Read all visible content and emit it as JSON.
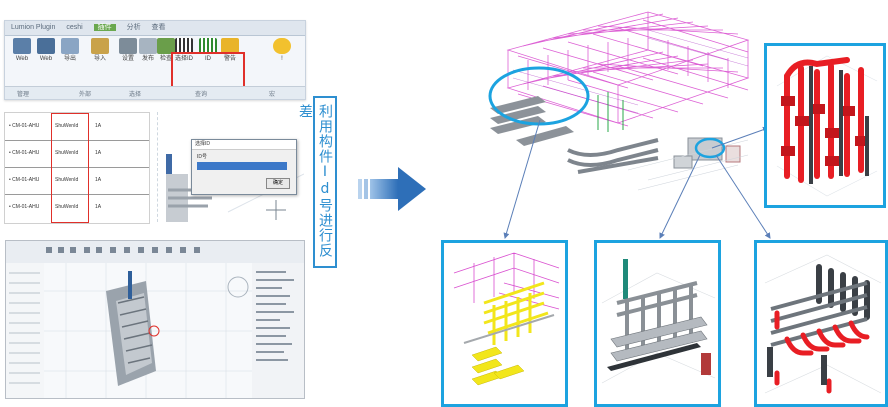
{
  "label": {
    "text": "利用构件Id号进行反差"
  },
  "ribbon": {
    "tabs": [
      "Lumion Plugin",
      "ceshi",
      "插件",
      "分析",
      "查看"
    ],
    "buttons": [
      {
        "label": "Web",
        "icon": "web-icon"
      },
      {
        "label": "Web",
        "icon": "web-icon"
      },
      {
        "label": "导出",
        "icon": "export-icon"
      },
      {
        "label": "导入",
        "icon": "import-icon"
      },
      {
        "label": "设置",
        "icon": "settings-icon"
      },
      {
        "label": "发布",
        "icon": "publish-icon"
      },
      {
        "label": "检查",
        "icon": "check-icon"
      },
      {
        "label": "选择ID",
        "icon": "select-id-icon"
      },
      {
        "label": "ID",
        "icon": "id-icon"
      },
      {
        "label": "警告",
        "icon": "warning-icon"
      },
      {
        "label": "!",
        "icon": "alert-icon"
      }
    ],
    "groups": [
      "管理",
      "外部",
      "选择",
      "查询",
      "宏"
    ]
  },
  "table": {
    "rows": [
      [
        "•   CM-01-AHU",
        "ShuWenId",
        "1A"
      ],
      [
        "•   CM-01-AHU",
        "ShuWenId",
        "1A"
      ],
      [
        "•   CM-01-AHU",
        "ShuWenId",
        "1A"
      ],
      [
        "•   CM-01-AHU",
        "ShuWenId",
        "1A"
      ]
    ]
  },
  "dialog": {
    "title": "选择ID",
    "field_label": "ID号",
    "ok_label": "确定"
  },
  "colors": {
    "accent": "#1ca3e0",
    "highlight": "#e0302a",
    "pipe_magenta": "#d94fd0",
    "pipe_red": "#e81e24",
    "pipe_yellow": "#f2e61b"
  }
}
